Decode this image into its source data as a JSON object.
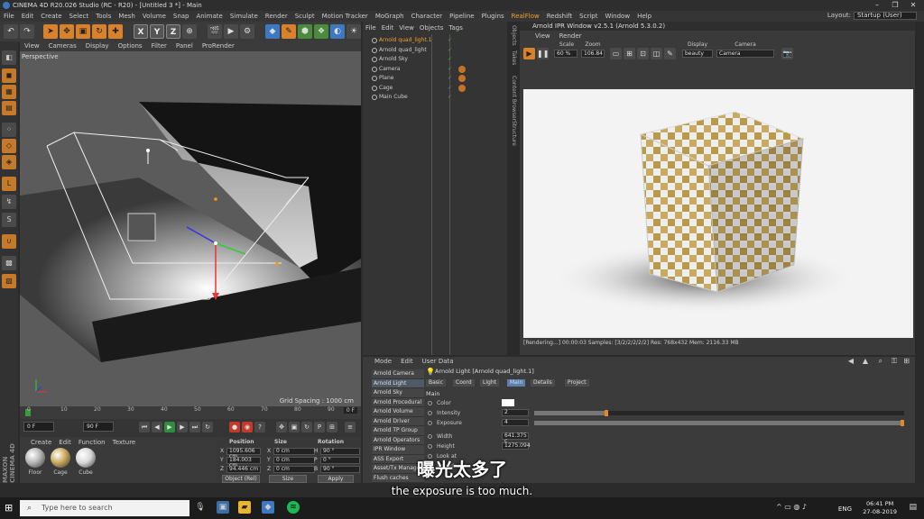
{
  "window": {
    "title": "CINEMA 4D R20.026 Studio (RC - R20) - [Untitled 3 *] - Main"
  },
  "menubar": {
    "items": [
      "File",
      "Edit",
      "Create",
      "Select",
      "Tools",
      "Mesh",
      "Volume",
      "Snap",
      "Animate",
      "Simulate",
      "Render",
      "Sculpt",
      "Motion Tracker",
      "MoGraph",
      "Character",
      "Pipeline",
      "Plugins",
      "RealFlow",
      "Redshift",
      "Script",
      "Window",
      "Help"
    ],
    "highlighted": "RealFlow",
    "layout_label": "Layout:",
    "layout_value": "Startup (User)"
  },
  "toolbar": {
    "axis_x": "X",
    "axis_y": "Y",
    "axis_z": "Z"
  },
  "viewport": {
    "menu": [
      "View",
      "Cameras",
      "Display",
      "Options",
      "Filter",
      "Panel",
      "ProRender"
    ],
    "label": "Perspective",
    "grid_spacing": "Grid Spacing : 1000 cm"
  },
  "timeline": {
    "ticks": [
      "0",
      "10",
      "20",
      "30",
      "40",
      "50",
      "60",
      "70",
      "80",
      "90"
    ],
    "end_marker": "0 F"
  },
  "transport": {
    "start_frame": "0 F",
    "end_frame": "90 F"
  },
  "materials": {
    "menu": [
      "Create",
      "Edit",
      "Function",
      "Texture"
    ],
    "items": [
      {
        "name": "Floor",
        "color": "#b5b5b5"
      },
      {
        "name": "Cage",
        "color": "#c9a85a"
      },
      {
        "name": "Cube",
        "color": "#d8d8d8"
      }
    ]
  },
  "coordinates": {
    "headers": [
      "Position",
      "Size",
      "Rotation"
    ],
    "rows": [
      {
        "axis": "X",
        "pos": "1095.606 cm",
        "size_axis": "X",
        "size": "0 cm",
        "rot_axis": "H",
        "rot": "90 °"
      },
      {
        "axis": "Y",
        "pos": "184.003 cm",
        "size_axis": "Y",
        "size": "0 cm",
        "rot_axis": "P",
        "rot": "0 °"
      },
      {
        "axis": "Z",
        "pos": "94.446 cm",
        "size_axis": "Z",
        "size": "0 cm",
        "rot_axis": "B",
        "rot": "90 °"
      }
    ],
    "mode": "Object (Rel)",
    "size_mode": "Size",
    "apply": "Apply"
  },
  "object_manager": {
    "menu": [
      "File",
      "Edit",
      "View",
      "Objects",
      "Tags"
    ],
    "objects": [
      {
        "name": "Arnold quad_light.1",
        "selected": true
      },
      {
        "name": "Arnold quad_light",
        "selected": false
      },
      {
        "name": "Arnold Sky",
        "selected": false
      },
      {
        "name": "Camera",
        "selected": false
      },
      {
        "name": "Plane",
        "selected": false
      },
      {
        "name": "Cage",
        "selected": false
      },
      {
        "name": "Main Cube",
        "selected": false
      }
    ]
  },
  "side_tabs": [
    "Objects",
    "Takes",
    "Content Browser",
    "Structure"
  ],
  "ipr": {
    "title": "Arnold IPR Window v2.5.1 (Arnold 5.3.0.2)",
    "menu": [
      "View",
      "Render"
    ],
    "scale_label": "Scale",
    "scale_value": "60 %",
    "zoom_label": "Zoom",
    "zoom_value": "106.84",
    "display_label": "Display",
    "display_value": "beauty",
    "camera_label": "Camera",
    "camera_value": "Camera",
    "status": "[Rendering...] 00:00:03  Samples: [3/2/2/2/2/2]  Res: 768x432  Mem: 2116.33 MB"
  },
  "attributes": {
    "menu": [
      "Mode",
      "Edit",
      "User Data"
    ],
    "arnold_menu": [
      "Arnold Camera",
      "Arnold Light",
      "Arnold Sky",
      "Arnold Procedural",
      "Arnold Volume",
      "Arnold Driver",
      "Arnold TP Group",
      "Arnold Operators",
      "IPR Window",
      "ASS Export",
      "Asset/Tx Manager",
      "Flush caches"
    ],
    "arnold_menu_active": "Arnold Light",
    "title": "Arnold Light [Arnold quad_light.1]",
    "tabs": [
      "Basic",
      "Coord",
      "Light",
      "Main",
      "Details",
      "Project"
    ],
    "active_tab": "Main",
    "section": "Main",
    "params": [
      {
        "label": "Color",
        "value": "",
        "fill": 0
      },
      {
        "label": "Intensity",
        "value": "2",
        "fill": 0.2
      },
      {
        "label": "Exposure",
        "value": "4",
        "fill": 1
      },
      {
        "label": "Width",
        "value": "641.375 c",
        "fill": 0
      },
      {
        "label": "Height",
        "value": "1275.094",
        "fill": 0
      },
      {
        "label": "Look at",
        "value": "",
        "fill": 0
      },
      {
        "label": "Roundness",
        "value": "",
        "fill": 0
      }
    ]
  },
  "taskbar": {
    "search_placeholder": "Type here to search",
    "language": "ENG",
    "time": "06:41 PM",
    "date": "27-08-2019"
  },
  "branding": {
    "side_logo": "MAXON CINEMA 4D"
  },
  "subtitles": {
    "chinese": "曝光太多了",
    "english": "the exposure is too much."
  }
}
